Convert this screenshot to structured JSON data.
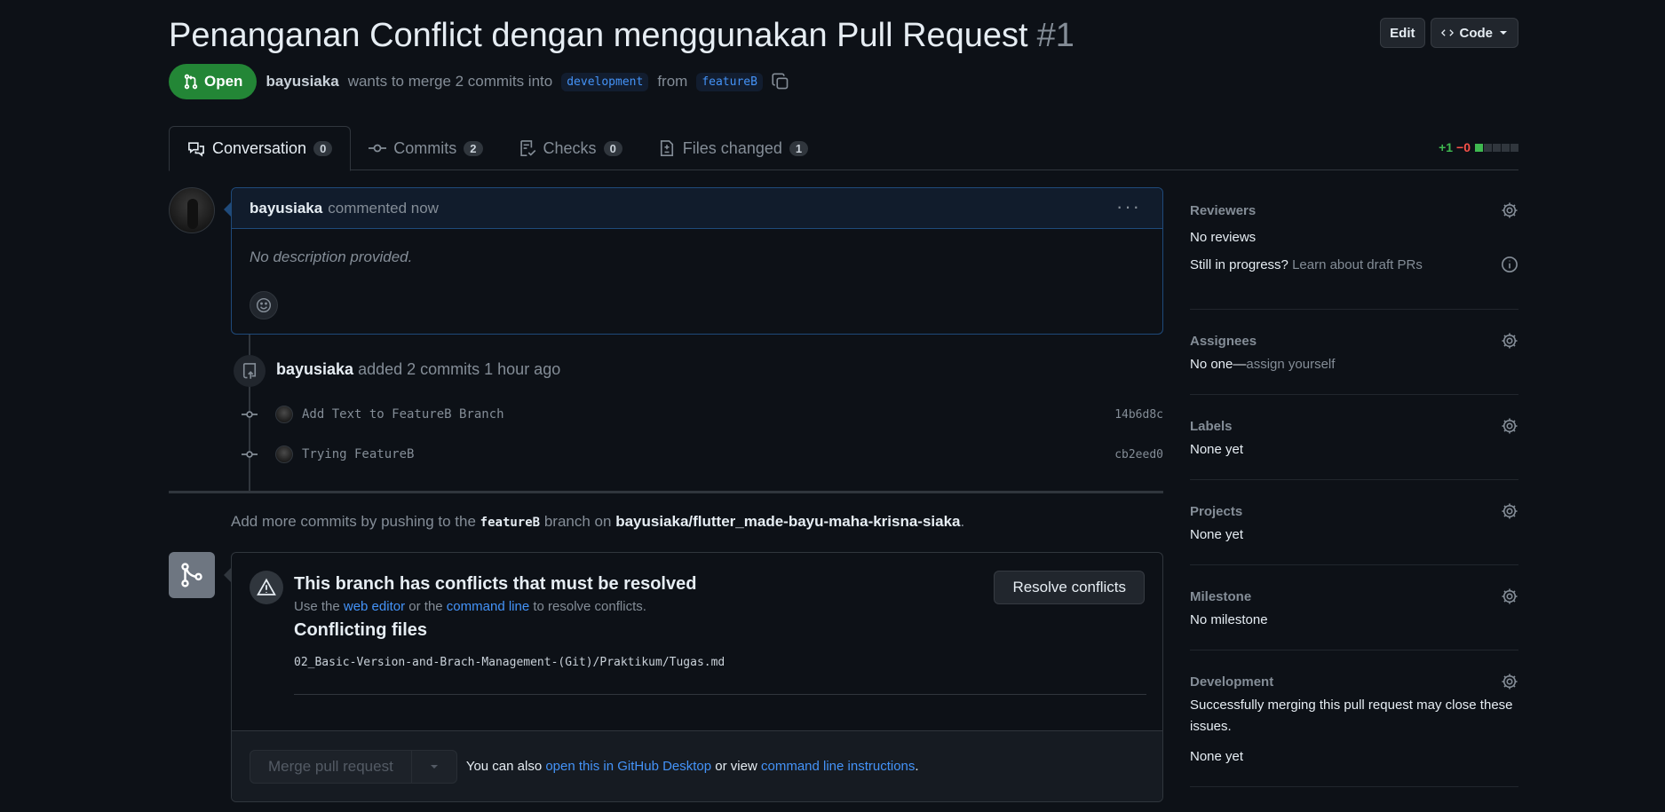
{
  "header": {
    "title": "Penanganan Conflict dengan menggunakan Pull Request",
    "number": "#1",
    "edit_label": "Edit",
    "code_label": "Code",
    "state": "Open",
    "author": "bayusiaka",
    "merge_text": "wants to merge 2 commits into",
    "base_branch": "development",
    "from_text": "from",
    "head_branch": "featureB"
  },
  "tabs": [
    {
      "label": "Conversation",
      "count": "0"
    },
    {
      "label": "Commits",
      "count": "2"
    },
    {
      "label": "Checks",
      "count": "0"
    },
    {
      "label": "Files changed",
      "count": "1"
    }
  ],
  "diffstat": {
    "additions": "+1",
    "deletions": "−0"
  },
  "comment": {
    "author": "bayusiaka",
    "action": "commented now",
    "body": "No description provided."
  },
  "commits_event": {
    "author": "bayusiaka",
    "text": "added 2 commits 1 hour ago",
    "commits": [
      {
        "message": "Add Text to FeatureB Branch",
        "sha": "14b6d8c"
      },
      {
        "message": "Trying FeatureB",
        "sha": "cb2eed0"
      }
    ]
  },
  "push_hint": {
    "prefix": "Add more commits by pushing to the",
    "branch": "featureB",
    "middle": "branch on",
    "repo": "bayusiaka/flutter_made-bayu-maha-krisna-siaka",
    "suffix": "."
  },
  "merge": {
    "conflict_title": "This branch has conflicts that must be resolved",
    "desc_prefix": "Use the",
    "web_editor": "web editor",
    "desc_middle": "or the",
    "command_line": "command line",
    "desc_suffix": "to resolve conflicts.",
    "files_title": "Conflicting files",
    "file": "02_Basic-Version-and-Brach-Management-(Git)/Praktikum/Tugas.md",
    "resolve_label": "Resolve conflicts",
    "merge_label": "Merge pull request",
    "alt_prefix": "You can also",
    "alt_desktop": "open this in GitHub Desktop",
    "alt_middle": "or view",
    "alt_cli": "command line instructions",
    "alt_suffix": "."
  },
  "sidebar": {
    "reviewers": {
      "heading": "Reviewers",
      "value": "No reviews",
      "draft_prefix": "Still in progress?",
      "draft_link": "Learn about draft PRs"
    },
    "assignees": {
      "heading": "Assignees",
      "value": "No one—",
      "assign_link": "assign yourself"
    },
    "labels": {
      "heading": "Labels",
      "value": "None yet"
    },
    "projects": {
      "heading": "Projects",
      "value": "None yet"
    },
    "milestone": {
      "heading": "Milestone",
      "value": "No milestone"
    },
    "development": {
      "heading": "Development",
      "desc": "Successfully merging this pull request may close these issues.",
      "value": "None yet"
    }
  },
  "colors": {
    "accent": "#4493f8",
    "open": "#238636",
    "additions": "#3fb950",
    "deletions": "#f85149"
  }
}
